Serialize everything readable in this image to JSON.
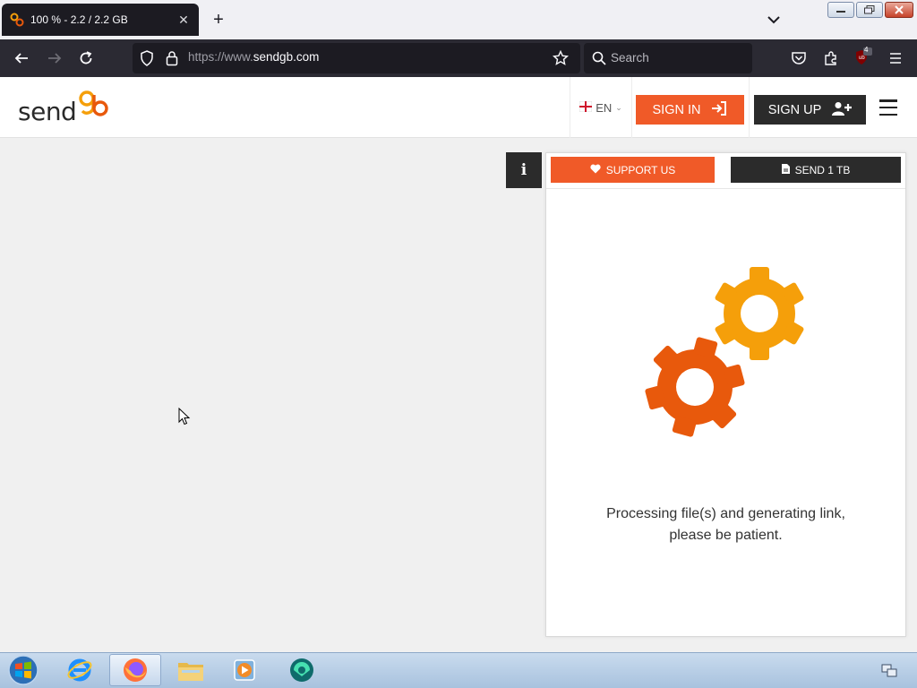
{
  "browser": {
    "tab_title": "100 % - 2.2 / 2.2 GB",
    "url_prefix": "https://www.",
    "url_host": "sendgb.com",
    "search_placeholder": "Search",
    "notification_badge": "4"
  },
  "site": {
    "logo_text": "send",
    "logo_mark": "gb",
    "lang_label": "EN",
    "sign_in_label": "SIGN IN",
    "sign_up_label": "SIGN UP"
  },
  "panel": {
    "info_label": "i",
    "support_label": "SUPPORT US",
    "send1tb_label": "SEND 1 TB",
    "processing_line1": "Processing file(s) and generating link,",
    "processing_line2": "please be patient."
  },
  "colors": {
    "brand_orange": "#f05a28",
    "brand_dark": "#2b2b2b",
    "gear_large": "#e8590c",
    "gear_small": "#f59f0a"
  },
  "taskbar": {
    "items": [
      "internet-explorer-icon",
      "firefox-icon",
      "file-explorer-icon",
      "media-player-icon",
      "app-icon"
    ]
  }
}
